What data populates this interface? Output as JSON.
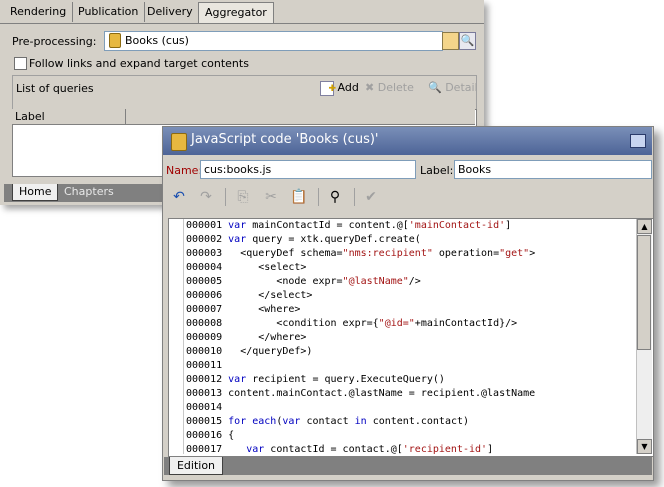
{
  "back_window": {
    "tabs": [
      "Rendering",
      "Publication",
      "Delivery",
      "Aggregator"
    ],
    "active_tab": "Aggregator",
    "preprocessing": {
      "label": "Pre-processing:",
      "value": "Books (cus)"
    },
    "follow_links": {
      "label": "Follow links and expand target contents",
      "checked": false
    },
    "queries": {
      "title": "List of queries",
      "add_label": "Add",
      "delete_label": "Delete",
      "detail_label": "Detail",
      "column_label": "Label"
    },
    "bottom_tabs": [
      "Home",
      "Chapters"
    ]
  },
  "front_window": {
    "title": "JavaScript code 'Books (cus)'",
    "name_label": "Name:",
    "name_value": "cus:books.js",
    "label_label": "Label:",
    "label_value": "Books",
    "toolbar_icons": [
      "undo-icon",
      "redo-icon",
      "copy-icon",
      "cut-icon",
      "paste-icon",
      "find-icon",
      "check-icon"
    ],
    "code_lines": [
      {
        "num": "000001",
        "text": "var mainContactId = content.@['mainContact-id']"
      },
      {
        "num": "000002",
        "text": "var query = xtk.queryDef.create("
      },
      {
        "num": "000003",
        "text": "  <queryDef schema=\"nms:recipient\" operation=\"get\">"
      },
      {
        "num": "000004",
        "text": "     <select>"
      },
      {
        "num": "000005",
        "text": "        <node expr=\"@lastName\"/>"
      },
      {
        "num": "000006",
        "text": "     </select>"
      },
      {
        "num": "000007",
        "text": "     <where>"
      },
      {
        "num": "000008",
        "text": "        <condition expr={\"@id=\"+mainContactId}/>"
      },
      {
        "num": "000009",
        "text": "     </where>"
      },
      {
        "num": "000010",
        "text": "  </queryDef>)"
      },
      {
        "num": "000011",
        "text": ""
      },
      {
        "num": "000012",
        "text": "var recipient = query.ExecuteQuery()"
      },
      {
        "num": "000013",
        "text": "content.mainContact.@lastName = recipient.@lastName"
      },
      {
        "num": "000014",
        "text": ""
      },
      {
        "num": "000015",
        "text": "for each(var contact in content.contact)"
      },
      {
        "num": "000016",
        "text": "{"
      },
      {
        "num": "000017",
        "text": "   var contactId = contact.@['recipient-id']"
      }
    ],
    "bottom_tab": "Edition"
  },
  "colors": {
    "title_bar": "#4d6497",
    "keyword": "#0000c0",
    "string": "#a31515",
    "name_label": "#a00000"
  }
}
